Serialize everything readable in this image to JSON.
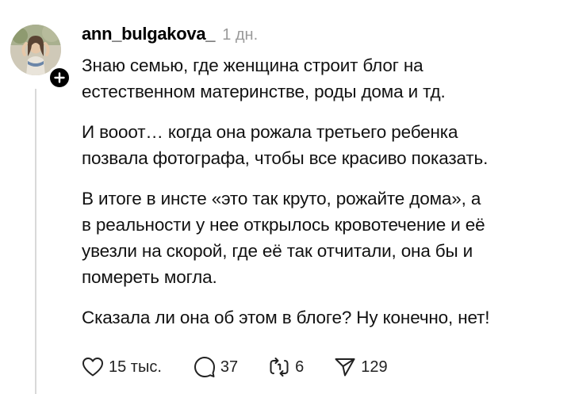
{
  "post": {
    "username": "ann_bulgakova_",
    "time": "1 дн.",
    "paragraphs": [
      "Знаю семью, где женщина строит блог на\nестественном материнстве, роды дома и тд.",
      "И вооот… когда она рожала третьего ребенка\nпозвала фотографа, чтобы все красиво показать.",
      "В итоге в инсте «это так круто, рожайте дома», а\nв реальности у нее открылось кровотечение и её\nувезли на скорой, где её так отчитали, она бы и\nпомереть могла.",
      "Сказала ли она об этом в блоге? Ну конечно, нет!"
    ],
    "actions": {
      "likes": "15 тыс.",
      "replies": "37",
      "reposts": "6",
      "shares": "129"
    }
  },
  "icons": {
    "avatar": "avatar-photo",
    "follow": "plus-icon",
    "like": "heart-icon",
    "reply": "comment-icon",
    "repost": "repost-icon",
    "share": "send-icon"
  },
  "colors": {
    "text": "#111111",
    "muted": "#9a9a9a",
    "thread_line": "#d9d9d9",
    "badge": "#000000"
  }
}
